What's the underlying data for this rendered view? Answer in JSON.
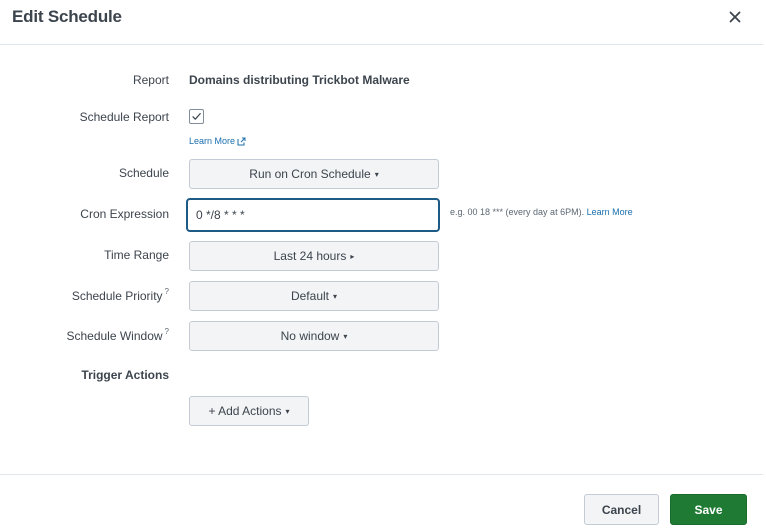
{
  "dialog": {
    "title": "Edit Schedule",
    "close_icon": "close-icon"
  },
  "form": {
    "report": {
      "label": "Report",
      "value": "Domains distributing Trickbot Malware"
    },
    "schedule_report": {
      "label": "Schedule Report",
      "checked": true,
      "learn_more": "Learn More",
      "learn_more_icon": "external-link-icon"
    },
    "schedule": {
      "label": "Schedule",
      "value": "Run on Cron Schedule",
      "caret": "▾"
    },
    "cron_expression": {
      "label": "Cron Expression",
      "value": "0 */8 * * *",
      "hint": "e.g. 00 18 *** (every day at 6PM).",
      "hint_link": "Learn More"
    },
    "time_range": {
      "label": "Time Range",
      "value": "Last 24 hours",
      "caret": "▸"
    },
    "schedule_priority": {
      "label": "Schedule Priority",
      "help": "?",
      "value": "Default",
      "caret": "▾"
    },
    "schedule_window": {
      "label": "Schedule Window",
      "help": "?",
      "value": "No window",
      "caret": "▾"
    },
    "trigger_actions": {
      "title": "Trigger Actions",
      "add_button": "+ Add Actions",
      "caret": "▾"
    }
  },
  "footer": {
    "cancel": "Cancel",
    "save": "Save"
  },
  "colors": {
    "primary_green": "#1f7a33",
    "link_blue": "#1a6fae",
    "focus_border": "#1d5a86",
    "text": "#3c444d"
  }
}
